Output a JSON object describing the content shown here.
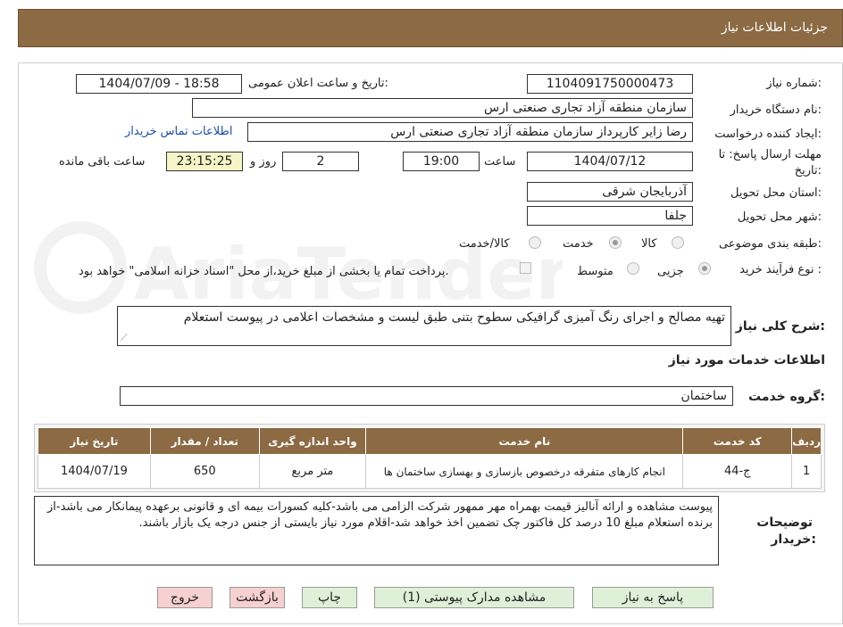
{
  "header": {
    "title": "جزئیات اطلاعات نیاز"
  },
  "fields": {
    "need_number_label": "شماره نیاز:",
    "need_number": "1104091750000473",
    "announce_label": "تاریخ و ساعت اعلان عمومی:",
    "announce_value": "1404/07/09 - 18:58",
    "buyer_label": "نام دستگاه خریدار:",
    "buyer_value": "سازمان منطقه آزاد تجاری صنعتی ارس",
    "creator_label": "ایجاد کننده درخواست:",
    "creator_value": "رضا زاير کارپرداز سازمان منطقه آزاد تجاری صنعتی ارس",
    "contact_link": "اطلاعات تماس خریدار",
    "deadline_label_1": "مهلت ارسال پاسخ: تا",
    "deadline_label_2": "تاریخ:",
    "deadline_date": "1404/07/12",
    "time_label": "ساعت",
    "deadline_time": "19:00",
    "days_value": "2",
    "days_label": "روز و",
    "remaining_value": "23:15:25",
    "remaining_label": "ساعت باقی مانده",
    "province_label": "استان محل تحویل:",
    "province_value": "آذربایجان شرقی",
    "city_label": "شهر محل تحویل:",
    "city_value": "جلفا",
    "category_label": "طبقه بندی موضوعی:",
    "category_options": [
      "کالا",
      "خدمت",
      "کالا/خدمت"
    ],
    "category_selected": "خدمت",
    "process_label": "نوع فرآیند خرید :",
    "process_options": [
      "جزیی",
      "متوسط"
    ],
    "process_selected": "جزیی",
    "payment_note": "پرداخت تمام یا بخشی از مبلغ خرید،از محل \"اسناد خزانه اسلامی\" خواهد بود.",
    "desc_label": "شرح کلی نیاز:",
    "desc_value": "تهیه مصالح و اجرای رنگ آمیزی گرافیکی سطوح بتنی طبق لیست و مشخصات اعلامی در پیوست استعلام",
    "services_title": "اطلاعات خدمات مورد نیاز",
    "group_label": "گروه خدمت:",
    "group_value": "ساختمان"
  },
  "table": {
    "headers": [
      "ردیف",
      "کد خدمت",
      "نام خدمت",
      "واحد اندازه گیری",
      "تعداد / مقدار",
      "تاریخ نیاز"
    ],
    "rows": [
      [
        "1",
        "ج-44",
        "انجام کارهای متفرقه درخصوص بازسازی و بهسازی ساختمان ها",
        "متر مربع",
        "650",
        "1404/07/19"
      ]
    ]
  },
  "notes": {
    "label_1": "توضیحات",
    "label_2": "خریدار:",
    "text": "پیوست مشاهده و ارائه آنالیز قیمت بهمراه مهر ممهور شرکت الزامی می باشد-کلیه کسورات بیمه ای و قانونی برعهده پیمانکار می باشد-از برنده استعلام مبلغ 10 درصد کل فاکتور چک تضمین اخذ خواهد شد-اقلام مورد نیاز بایستی از جنس درجه یک بازار باشند."
  },
  "buttons": {
    "reply": "پاسخ به نیاز",
    "attachments": "مشاهده مدارک پیوستی (1)",
    "print": "چاپ",
    "back": "بازگشت",
    "exit": "خروج"
  },
  "colors": {
    "header_bg": "#8b6a44",
    "button_green": "#dff0d8",
    "button_red": "#f7d0d0"
  },
  "watermark": "AriaTender.neT"
}
